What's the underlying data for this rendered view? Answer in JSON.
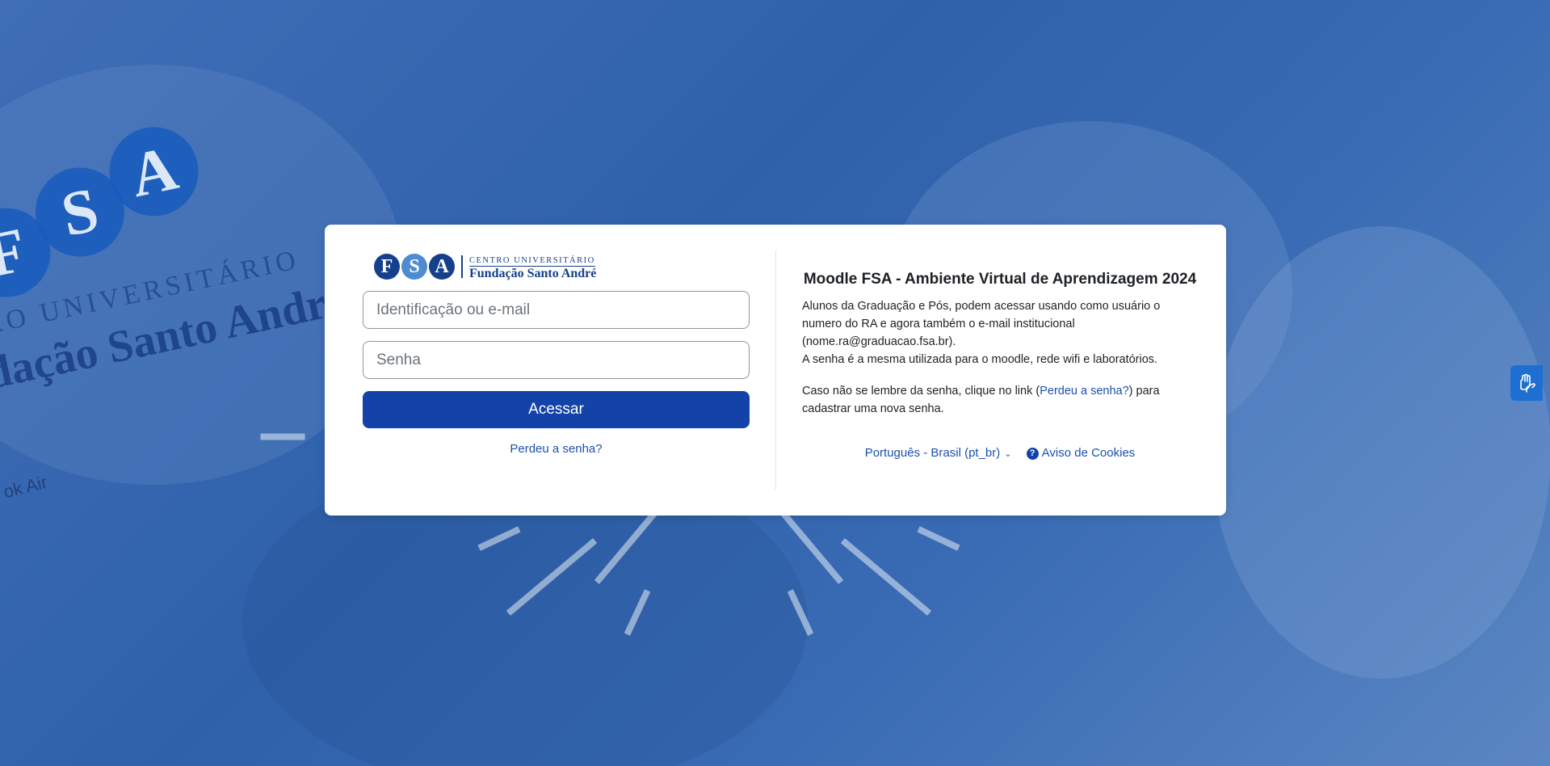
{
  "background": {
    "logo_letters": [
      "F",
      "S",
      "A"
    ],
    "logo_line1": "RO UNIVERSITÁRIO",
    "logo_line2": "dação Santo Andre",
    "laptop_text": "ok Air"
  },
  "brand": {
    "letters": [
      "F",
      "S",
      "A"
    ],
    "top_text": "CENTRO UNIVERSITÁRIO",
    "bottom_text": "Fundação Santo André"
  },
  "login": {
    "username_placeholder": "Identificação ou e-mail",
    "username_value": "",
    "password_placeholder": "Senha",
    "password_value": "",
    "submit_label": "Acessar",
    "forgot_label": "Perdeu a senha?"
  },
  "info": {
    "title": "Moodle FSA - Ambiente Virtual de Aprendizagem 2024",
    "p1_line1": "Alunos da Graduação e Pós, podem acessar usando como usuário o numero do RA e agora também o e-mail institucional (nome.ra@graduacao.fsa.br).",
    "p1_line2": "A senha é a mesma utilizada para o moodle, rede wifi e laboratórios.",
    "p2_before": "Caso não se lembre da senha, clique no link (",
    "p2_link": "Perdeu a senha?",
    "p2_after": ") para cadastrar uma nova senha."
  },
  "footer": {
    "language_selected": "Português - Brasil (pt_br)",
    "cookies_label": "Aviso de Cookies"
  },
  "colors": {
    "primary": "#1343a8",
    "link": "#1a50b0",
    "overlay": "#2f61ab",
    "accessibility_button": "#1e6fd2"
  },
  "icons": {
    "chevron": "chevron-down-icon",
    "help": "question-circle-icon",
    "accessibility": "sign-language-hands-icon"
  }
}
